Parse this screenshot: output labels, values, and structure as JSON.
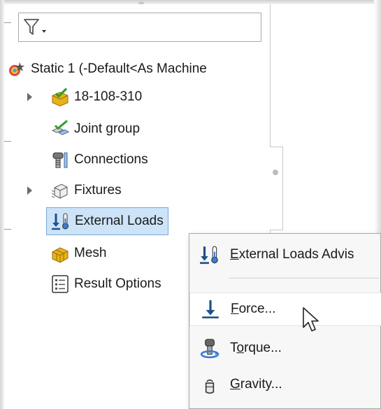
{
  "tree": {
    "study": "Static 1 (-Default<As Machine",
    "items": [
      {
        "label": "18-108-310",
        "icon": "part-check-icon",
        "expandable": true
      },
      {
        "label": "Joint group",
        "icon": "joint-group-icon",
        "expandable": false
      },
      {
        "label": "Connections",
        "icon": "connections-icon",
        "expandable": false
      },
      {
        "label": "Fixtures",
        "icon": "fixtures-icon",
        "expandable": true
      },
      {
        "label": "External Loads",
        "icon": "external-loads-icon",
        "expandable": false,
        "selected": true
      },
      {
        "label": "Mesh",
        "icon": "mesh-icon",
        "expandable": false
      },
      {
        "label": "Result Options",
        "icon": "result-options-icon",
        "expandable": false
      }
    ]
  },
  "context_menu": {
    "items": [
      {
        "label": "External Loads Advis",
        "accel": "E",
        "rest": "xternal Loads Advis",
        "icon": "external-loads-advisor-icon"
      },
      {
        "label": "Force...",
        "accel": "F",
        "rest": "orce...",
        "icon": "force-arrow-icon"
      },
      {
        "label": "Torque...",
        "accel": "o",
        "pre": "T",
        "rest": "rque...",
        "icon": "torque-icon"
      },
      {
        "label": "Gravity...",
        "accel": "G",
        "rest": "ravity...",
        "icon": "gravity-icon"
      }
    ]
  },
  "colors": {
    "selection_bg": "#cde3f8",
    "selection_border": "#7aa7d6",
    "check_green": "#2e9e2e",
    "part_yellow": "#e8b21a",
    "arrow_blue": "#1f4f8a"
  }
}
